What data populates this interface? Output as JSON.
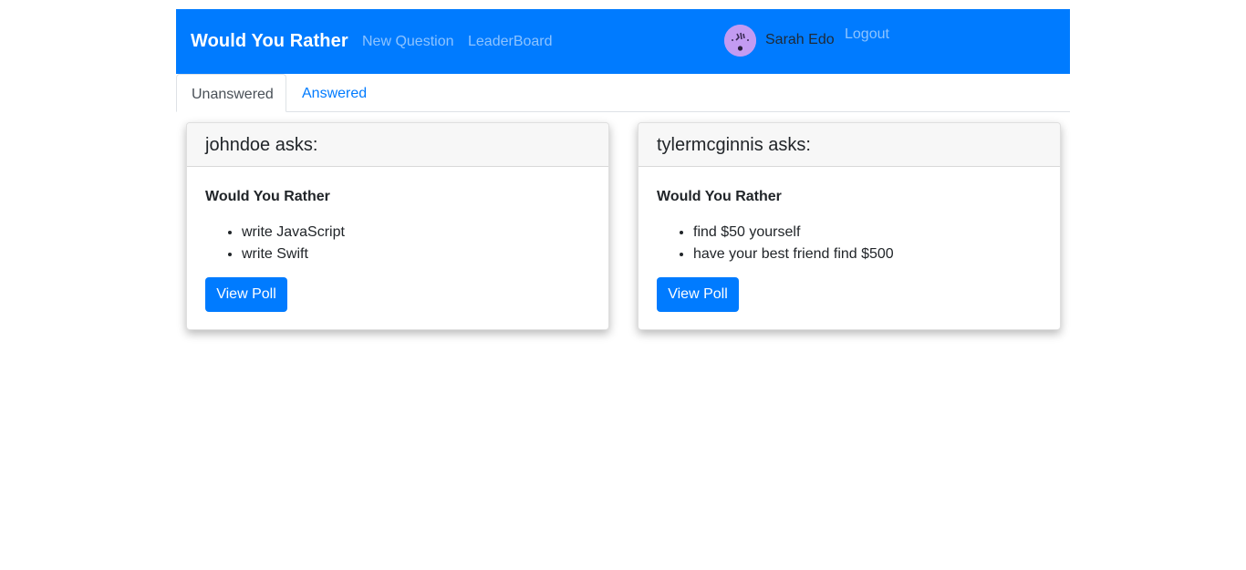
{
  "navbar": {
    "brand": "Would You Rather",
    "links": [
      "New Question",
      "LeaderBoard"
    ],
    "user_name": "Sarah Edo",
    "logout_label": "Logout",
    "bg_color": "#007bff"
  },
  "tabs": [
    {
      "label": "Unanswered",
      "active": true
    },
    {
      "label": "Answered",
      "active": false
    }
  ],
  "questions": [
    {
      "header": "johndoe asks:",
      "title": "Would You Rather",
      "options": [
        "write JavaScript",
        "write Swift"
      ],
      "button_label": "View Poll"
    },
    {
      "header": "tylermcginnis asks:",
      "title": "Would You Rather",
      "options": [
        "find $50 yourself",
        "have your best friend find $500"
      ],
      "button_label": "View Poll"
    }
  ]
}
